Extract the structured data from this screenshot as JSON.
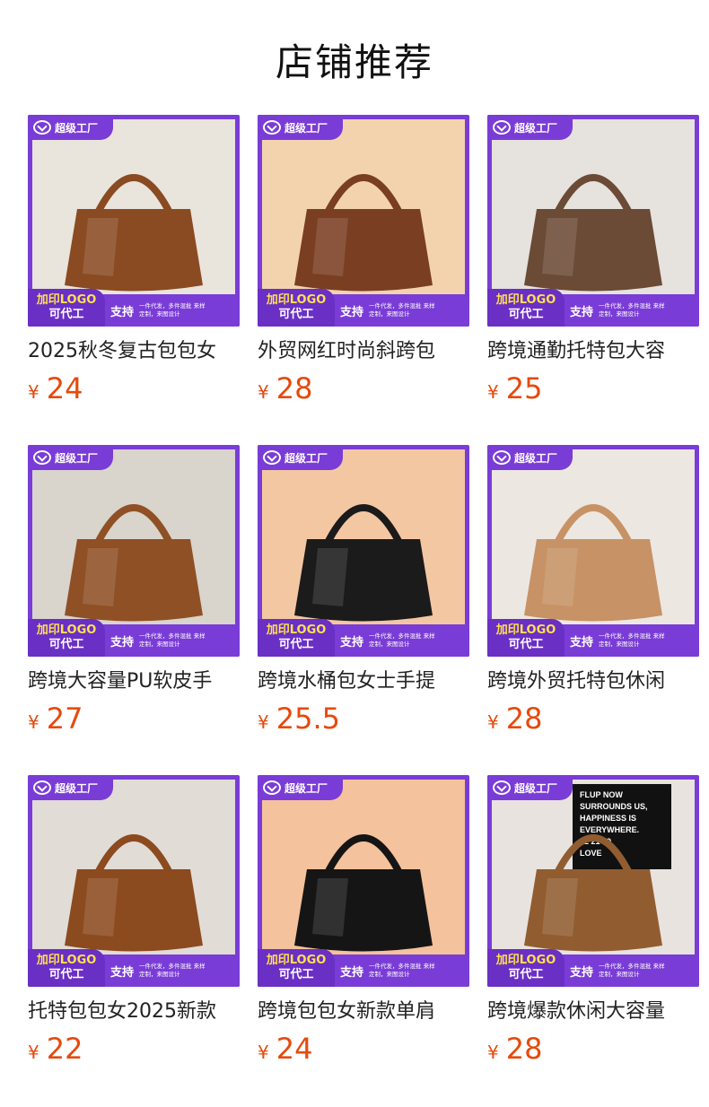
{
  "page": {
    "title": "店铺推荐"
  },
  "labels": {
    "badge": "超级工厂",
    "logo_line1": "加印LOGO",
    "logo_line2": "可代工",
    "support": "支持",
    "notes": "一件代发，多件混批 来样定制，来图设计",
    "currency": "¥"
  },
  "colors": {
    "accent_purple": "#7a3cd6",
    "price_orange": "#e64a0d",
    "logo_yellow": "#ffe14d"
  },
  "products": [
    {
      "name": "2025秋冬复古包包女",
      "price": "24",
      "bag_color": "#8a4a22",
      "bg": "#e9e4dc"
    },
    {
      "name": "外贸网红时尚斜跨包",
      "price": "28",
      "bag_color": "#7a3e22",
      "bg": "#f3d3ae"
    },
    {
      "name": "跨境通勤托特包大容",
      "price": "25",
      "bag_color": "#6b4a36",
      "bg": "#e6e2dd"
    },
    {
      "name": "跨境大容量PU软皮手",
      "price": "27",
      "bag_color": "#8f5025",
      "bg": "#d9d4cc"
    },
    {
      "name": "跨境水桶包女士手提",
      "price": "25.5",
      "bag_color": "#1b1b1b",
      "bg": "#f4c7a3"
    },
    {
      "name": "跨境外贸托特包休闲",
      "price": "28",
      "bag_color": "#c79265",
      "bg": "#ece7e1"
    },
    {
      "name": "托特包包女2025新款",
      "price": "22",
      "bag_color": "#8c4a1f",
      "bg": "#e1dcd6"
    },
    {
      "name": "跨境包包女新款单肩",
      "price": "24",
      "bag_color": "#151515",
      "bg": "#f4c29c"
    },
    {
      "name": "跨境爆款休闲大容量",
      "price": "28",
      "bag_color": "#915d30",
      "bg": "#e8e3de",
      "poster": [
        "FLUP NOW",
        "SURROUNDS US,",
        "HAPPINESS IS",
        "EVERYWHERE.",
        "02 21 19",
        "LOVE"
      ]
    }
  ]
}
